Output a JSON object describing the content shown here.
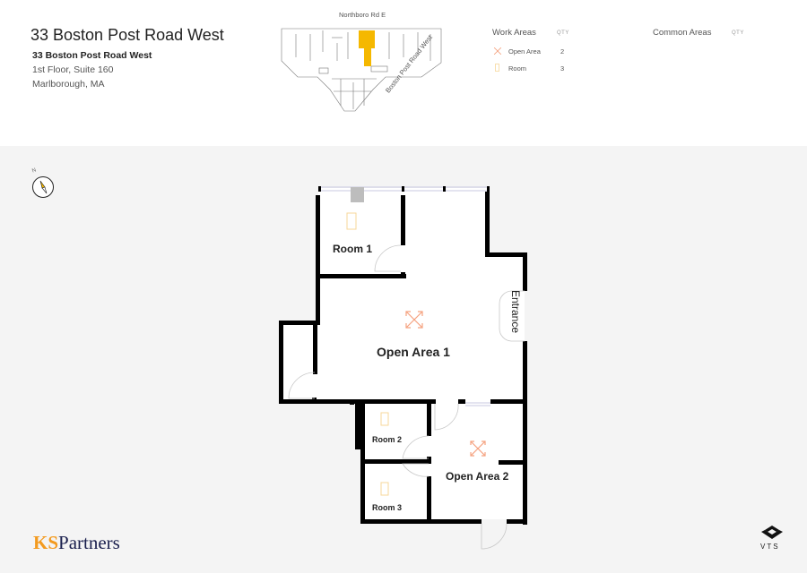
{
  "header": {
    "title": "33 Boston Post Road West",
    "address_line1": "33 Boston Post Road West",
    "address_line2": "1st Floor, Suite 160",
    "address_line3": "Marlborough, MA"
  },
  "keyplan": {
    "street_top": "Northboro Rd E",
    "street_diagonal": "Boston Post Road West",
    "suite_label": "Suite 160",
    "highlight_color": "#f5b800"
  },
  "legend": {
    "work_areas": {
      "heading": "Work Areas",
      "qty_heading": "QTY",
      "items": [
        {
          "label": "Open Area",
          "qty": "2",
          "icon": "open-area-icon"
        },
        {
          "label": "Room",
          "qty": "3",
          "icon": "room-icon"
        }
      ]
    },
    "common_areas": {
      "heading": "Common Areas",
      "qty_heading": "QTY"
    }
  },
  "compass": {
    "label": "N"
  },
  "floorplan": {
    "rooms": [
      {
        "id": "room-1",
        "label": "Room 1"
      },
      {
        "id": "room-2",
        "label": "Room 2"
      },
      {
        "id": "room-3",
        "label": "Room 3"
      },
      {
        "id": "open-area-1",
        "label": "Open Area 1"
      },
      {
        "id": "open-area-2",
        "label": "Open Area 2"
      }
    ],
    "entrance_label": "Entrance",
    "colors": {
      "open_area_icon": "#f5a27f",
      "room_icon": "#f7d79a",
      "wall": "#000000"
    }
  },
  "branding": {
    "ks": "KS",
    "partners": "Partners",
    "vts": "VTS"
  }
}
